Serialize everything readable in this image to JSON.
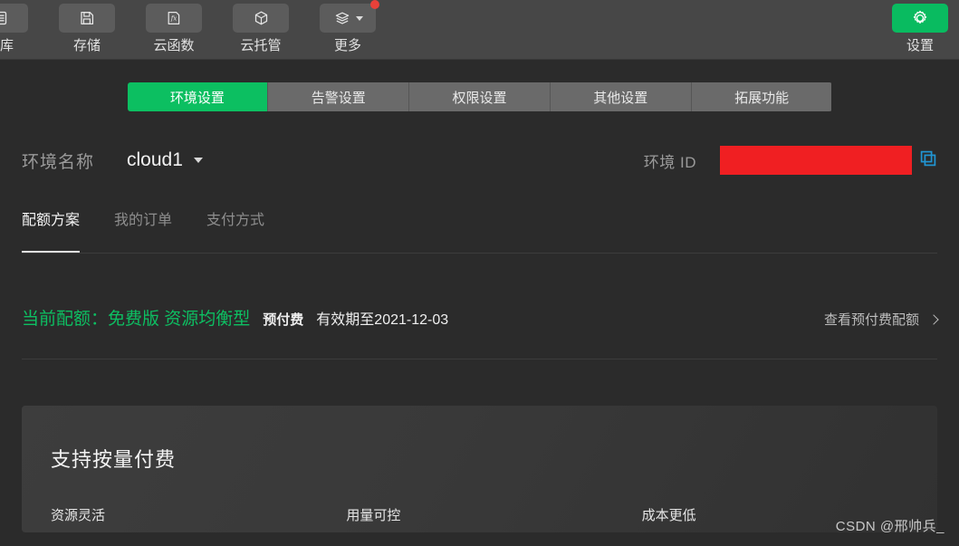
{
  "toolbar": {
    "items": [
      {
        "label": "据库",
        "icon": "database-icon",
        "badge": false,
        "caret": false,
        "clipped": true
      },
      {
        "label": "存储",
        "icon": "floppy-disk-icon",
        "badge": false,
        "caret": false,
        "clipped": false
      },
      {
        "label": "云函数",
        "icon": "fx-function-icon",
        "badge": false,
        "caret": false,
        "clipped": false
      },
      {
        "label": "云托管",
        "icon": "cube-icon",
        "badge": false,
        "caret": false,
        "clipped": false
      },
      {
        "label": "更多",
        "icon": "layers-icon",
        "badge": true,
        "caret": true,
        "clipped": false
      }
    ],
    "settings": {
      "label": "设置",
      "icon": "gear-icon"
    }
  },
  "tabs": [
    {
      "label": "环境设置",
      "active": true
    },
    {
      "label": "告警设置",
      "active": false
    },
    {
      "label": "权限设置",
      "active": false
    },
    {
      "label": "其他设置",
      "active": false
    },
    {
      "label": "拓展功能",
      "active": false
    }
  ],
  "environment": {
    "name_label": "环境名称",
    "name_value": "cloud1",
    "id_label": "环境 ID",
    "id_value": "",
    "id_redacted": true,
    "copy_icon": "copy-icon"
  },
  "subtabs": [
    {
      "label": "配额方案",
      "active": true
    },
    {
      "label": "我的订单",
      "active": false
    },
    {
      "label": "支付方式",
      "active": false
    }
  ],
  "quota": {
    "current_text": "当前配额：免费版 资源均衡型",
    "pay_mode": "预付费",
    "expiry": "有效期至2021-12-03",
    "link_label": "查看预付费配额"
  },
  "promo": {
    "title": "支持按量付费",
    "features": [
      "资源灵活",
      "用量可控",
      "成本更低"
    ]
  },
  "watermark": "CSDN @邢帅兵_",
  "colors": {
    "accent_green": "#0cbf61",
    "toolbar_bg": "#474747",
    "page_bg": "#2b2b2b",
    "redaction_red": "#f01f22",
    "copy_blue": "#2196d4",
    "badge_red": "#e8413a"
  }
}
